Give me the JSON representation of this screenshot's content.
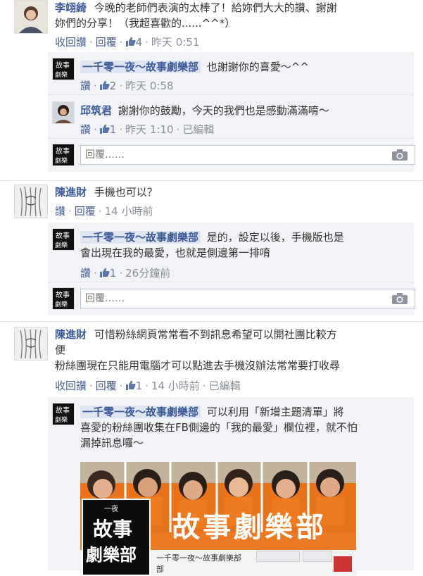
{
  "thread1": {
    "author": "李翊綺",
    "text": "今晚的老師們表演的太棒了！給妳們大大的讚、謝謝妳們的分享！（我超喜歡的......^^*）",
    "line1": "今晚的老師們表演的太棒了！給妳們大大的讚、謝謝",
    "line2": "妳們的分享！（我超喜歡的......^^*）",
    "actions": {
      "unlike": "收回讚",
      "reply": "回覆",
      "likes": "4",
      "time": "昨天 0:51"
    },
    "replies": [
      {
        "author": "一千零一夜～故事劇樂部",
        "text": "也謝謝你的喜愛～^^",
        "actions": {
          "like": "讚",
          "likes": "2",
          "time": "昨天 0:58"
        }
      },
      {
        "author": "邱筑君",
        "text": "謝謝你的鼓勵，今天的我們也是感動滿滿唷～",
        "actions": {
          "like": "讚",
          "likes": "1",
          "time": "昨天 1:10",
          "edited": "已編輯"
        }
      }
    ],
    "reply_placeholder": "回覆……"
  },
  "thread2": {
    "author": "陳進財",
    "text": "手機也可以？",
    "actions": {
      "like": "讚",
      "reply": "回覆",
      "time": "14 小時前"
    },
    "replies": [
      {
        "author": "一千零一夜～故事劇樂部",
        "line1": "是的，設定以後，手機版也是",
        "line2": "會出現在我的最愛，也就是側邊第一排唷",
        "actions": {
          "like": "讚",
          "likes": "1",
          "time": "26分鐘前"
        }
      }
    ],
    "reply_placeholder": "回覆……"
  },
  "thread3": {
    "author": "陳進財",
    "line1": "可惜粉絲網頁常常看不到訊息希望可以開社團比較方",
    "line2": "便",
    "line3": "粉絲團現在只能用電腦才可以點進去手機沒辦法常常要打收尋",
    "actions": {
      "unlike": "收回讚",
      "reply": "回覆",
      "likes": "1",
      "time": "14 小時前",
      "edited": "已編輯"
    },
    "replies": [
      {
        "author": "一千零一夜～故事劇樂部",
        "line1": "可以利用「新增主題清單」將",
        "line2": "喜愛的粉絲團收集在FB側邊的「我的最愛」欄位裡，就不怕",
        "line3": "漏掉訊息囉～"
      }
    ],
    "banner": {
      "title": "故事劇樂部",
      "logo_top": "一夜",
      "logo_mid": "故事",
      "logo_bot": "劇樂部",
      "page_name": "一千零一夜～故事劇樂部",
      "page_name_tail": "部"
    }
  },
  "colors": {
    "link": "#3b5998",
    "meta": "#6a7a9a",
    "orange": "#e9731b"
  }
}
